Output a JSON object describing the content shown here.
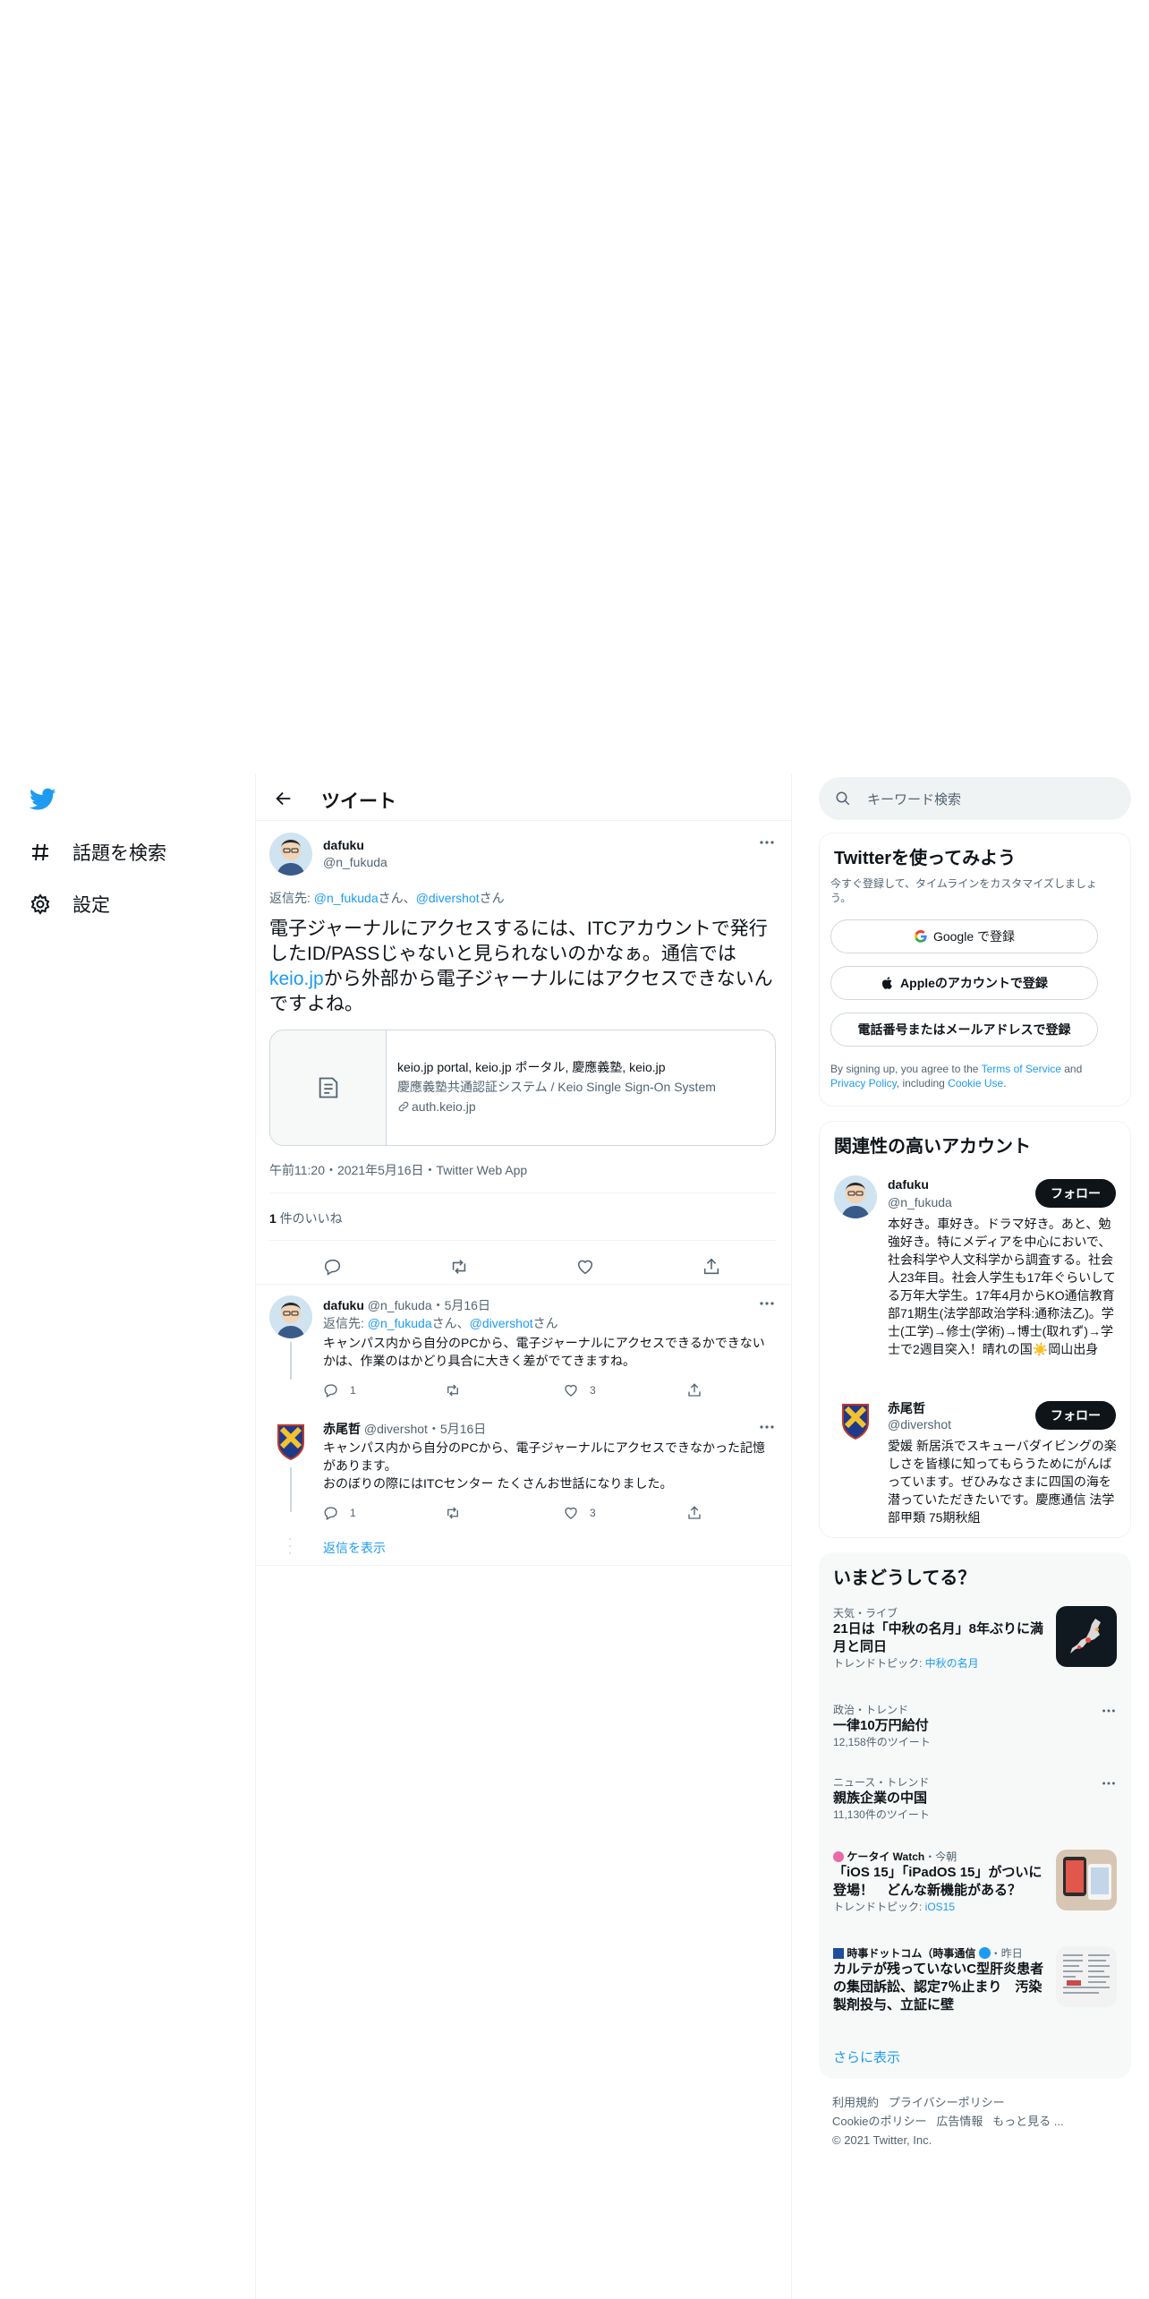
{
  "nav": {
    "explore_label": "話題を検索",
    "settings_label": "設定"
  },
  "header": {
    "title": "ツイート"
  },
  "tweet": {
    "author_name": "dafuku",
    "author_handle": "@n_fukuda",
    "reply_prefix": "返信先: ",
    "reply_to_1": "@n_fukuda",
    "reply_san_1": "さん、",
    "reply_to_2": "@divershot",
    "reply_san_2": "さん",
    "text_part1": "電子ジャーナルにアクセスするには、ITCアカウントで発行したID/PASSじゃないと見られないのかなぁ。通信では",
    "text_link": "keio.jp",
    "text_part2": "から外部から電子ジャーナルにはアクセスできないんですよね。",
    "card_title": "keio.jp portal, keio.jp ポータル, 慶應義塾, keio.jp",
    "card_description": "慶應義塾共通認証システム / Keio Single Sign-On System",
    "card_domain": "auth.keio.jp",
    "timestamp": "午前11:20・2021年5月16日・Twitter Web App",
    "likes_count": "1",
    "likes_label": " 件のいいね"
  },
  "replies": [
    {
      "name": "dafuku",
      "handle": "@n_fukuda",
      "date": "・5月16日",
      "reply_prefix": "返信先: ",
      "reply_to_1": "@n_fukuda",
      "reply_san_1": "さん、",
      "reply_to_2": "@divershot",
      "reply_san_2": "さん",
      "text": "キャンパス内から自分のPCから、電子ジャーナルにアクセスできるかできないかは、作業のはかどり具合に大きく差がでてきますね。",
      "reply_count": "1",
      "like_count": "3"
    },
    {
      "name": "赤尾哲",
      "handle": "@divershot",
      "date": "・5月16日",
      "text_line1": "キャンパス内から自分のPCから、電子ジャーナルにアクセスできなかった記憶があります。",
      "text_line2": "おのぼりの際にはITCセンター たくさんお世話になりました。",
      "reply_count": "1",
      "like_count": "3"
    }
  ],
  "show_replies_label": "返信を表示",
  "search": {
    "placeholder": "キーワード検索"
  },
  "signup": {
    "title": "Twitterを使ってみよう",
    "subtitle": "今すぐ登録して、タイムラインをカスタマイズしましょう。",
    "google_label": "Google で登録",
    "apple_label": "Appleのアカウントで登録",
    "phone_label": "電話番号またはメールアドレスで登録",
    "terms_1": "By signing up, you agree to the ",
    "terms_link": "Terms of Service",
    "terms_2": " and ",
    "privacy_link": "Privacy Policy",
    "terms_3": ", including ",
    "cookie_link": "Cookie Use",
    "terms_4": "."
  },
  "relevant": {
    "title": "関連性の高いアカウント",
    "follow_label": "フォロー",
    "accounts": [
      {
        "name": "dafuku",
        "handle": "@n_fukuda",
        "bio": "本好き。車好き。ドラマ好き。あと、勉強好き。特にメディアを中心においで、社会科学や人文科学から調査する。社会人23年目。社会人学生も17年ぐらいしてる万年大学生。17年4月からKO通信教育部71期生(法学部政治学科:通称法乙)。学士(工学)→修士(学術)→博士(取れず)→学士で2週目突入！晴れの国☀️岡山出身"
      },
      {
        "name": "赤尾哲",
        "handle": "@divershot",
        "bio": "愛媛 新居浜でスキューバダイビングの楽しさを皆様に知ってもらうためにがんばっています。ぜひみなさまに四国の海を潜っていただきたいです。慶應通信 法学部甲類 75期秋組"
      }
    ]
  },
  "trends": {
    "title": "いまどうしてる？",
    "items": [
      {
        "meta": "天気・ライブ",
        "title": "21日は「中秋の名月」8年ぶりに満月と同日",
        "sub_label": "トレンドトピック: ",
        "sub_link": "中秋の名月"
      },
      {
        "meta": "政治・トレンド",
        "title": "一律10万円給付",
        "sub": "12,158件のツイート"
      },
      {
        "meta": "ニュース・トレンド",
        "title": "親族企業の中国",
        "sub": "11,130件のツイート"
      },
      {
        "meta_source": "ケータイ Watch",
        "meta_time": "・今朝",
        "title": "「iOS 15」「iPadOS 15」がついに登場！　どんな新機能がある？",
        "sub_label": "トレンドトピック: ",
        "sub_link": "iOS15"
      },
      {
        "meta_source": "時事ドットコム（時事通信",
        "meta_time": "・昨日",
        "title": "カルテが残っていないC型肝炎患者の集団訴訟、認定7％止まり　汚染製剤投与、立証に壁"
      }
    ],
    "show_more": "さらに表示"
  },
  "footer": {
    "line1_a": "利用規約",
    "line1_b": "プライバシーポリシー",
    "line2_a": "Cookieのポリシー",
    "line2_b": "広告情報",
    "line2_c": "もっと見る ...",
    "copyright": "© 2021 Twitter, Inc."
  },
  "colors": {
    "accent": "#1d9bf0",
    "text": "#0f1419",
    "secondary": "#536471",
    "border": "#eff3f4"
  }
}
